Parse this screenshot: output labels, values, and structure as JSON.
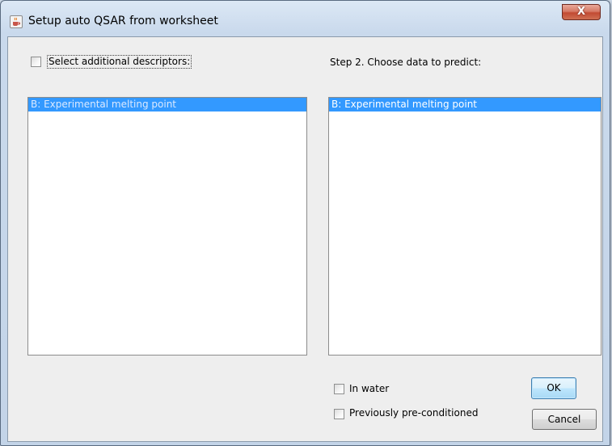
{
  "window": {
    "title": "Setup auto QSAR from worksheet",
    "icon": "java-coffee-cup-icon",
    "close_label": "X"
  },
  "left_panel": {
    "checkbox_label": "Select additional descriptors:",
    "checkbox_checked": false,
    "items": [
      "B: Experimental melting point"
    ],
    "selected_index": 0
  },
  "right_panel": {
    "step_label": "Step 2. Choose data to predict:",
    "items": [
      "B: Experimental melting point"
    ],
    "selected_index": 0
  },
  "options": {
    "in_water_label": "In water",
    "in_water_checked": false,
    "preconditioned_label": "Previously pre-conditioned",
    "preconditioned_checked": false
  },
  "buttons": {
    "ok_label": "OK",
    "cancel_label": "Cancel"
  },
  "colors": {
    "selection": "#3399ff",
    "close_button": "#c24a33",
    "default_button_border": "#3c7fb1"
  }
}
